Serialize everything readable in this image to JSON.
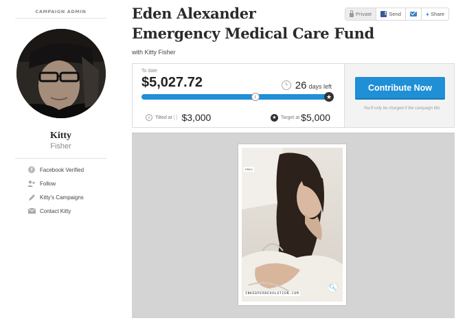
{
  "sidebar": {
    "admin_label": "CAMPAIGN ADMIN",
    "first_name": "Kitty",
    "last_name": "Fisher",
    "links": [
      {
        "label": "Facebook Verified",
        "icon": "facebook-verified-icon"
      },
      {
        "label": "Follow",
        "icon": "follow-icon"
      },
      {
        "label": "Kitty's Campaigns",
        "icon": "pencil-icon"
      },
      {
        "label": "Contact Kitty",
        "icon": "envelope-icon"
      }
    ]
  },
  "campaign": {
    "title_line1": "Eden Alexander",
    "title_line2": "Emergency Medical Care Fund",
    "with_owner": "with Kitty Fisher"
  },
  "actions": {
    "private_label": "Private",
    "send_label": "Send",
    "share_label": "Share"
  },
  "stats": {
    "to_date_label": "To date",
    "amount_raised": "$5,027.72",
    "days_left_num": "26",
    "days_left_label": "days left",
    "tilted_label": "Tilted at",
    "tilt_amount": "$3,000",
    "target_label": "Target at",
    "target_amount": "$5,000",
    "progress_fraction": 1.0,
    "tilt_fraction": 0.6,
    "accent_color": "#1f8fd6"
  },
  "contribute": {
    "button_label": "Contribute Now",
    "note": "You'll only be charged if the campaign tilts"
  },
  "media": {
    "prev_tag": "PREV",
    "url_text": "INKEDPERREVOLUTION.COM"
  }
}
